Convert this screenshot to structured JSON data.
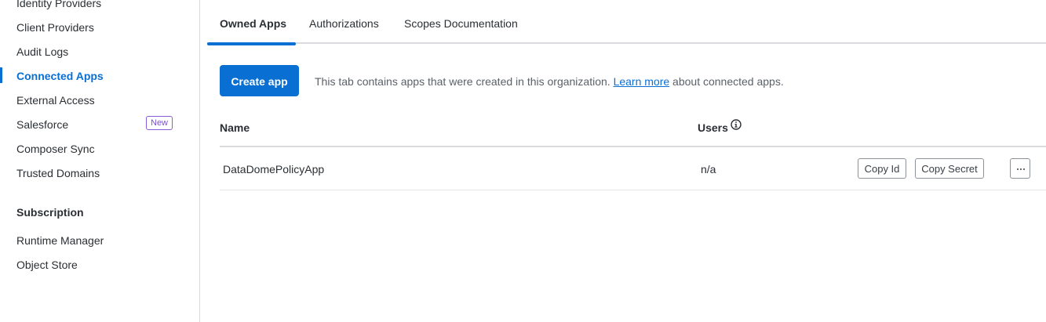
{
  "sidebar": {
    "items": [
      {
        "label": "Identity Providers"
      },
      {
        "label": "Client Providers"
      },
      {
        "label": "Audit Logs"
      },
      {
        "label": "Connected Apps",
        "active": true
      },
      {
        "label": "External Access"
      },
      {
        "label": "Salesforce",
        "badge": "New"
      },
      {
        "label": "Composer Sync"
      },
      {
        "label": "Trusted Domains"
      }
    ],
    "subscription_title": "Subscription",
    "subscription_items": [
      {
        "label": "Runtime Manager"
      },
      {
        "label": "Object Store"
      }
    ]
  },
  "tabs": [
    {
      "label": "Owned Apps",
      "active": true
    },
    {
      "label": "Authorizations"
    },
    {
      "label": "Scopes Documentation"
    }
  ],
  "toolbar": {
    "create_label": "Create app",
    "info_prefix": "This tab contains apps that were created in this organization.",
    "info_link": "Learn more",
    "info_suffix": "about connected apps."
  },
  "table": {
    "columns": [
      "Name",
      "Users"
    ],
    "rows": [
      {
        "name": "DataDomePolicyApp",
        "users": "n/a",
        "copy_id_label": "Copy Id",
        "copy_secret_label": "Copy Secret"
      }
    ]
  },
  "icons": {
    "users_info": "info-icon",
    "row_more": "more-horizontal-icon"
  },
  "colors": {
    "accent": "#0a6fd3",
    "badge": "#7a4fd1"
  }
}
